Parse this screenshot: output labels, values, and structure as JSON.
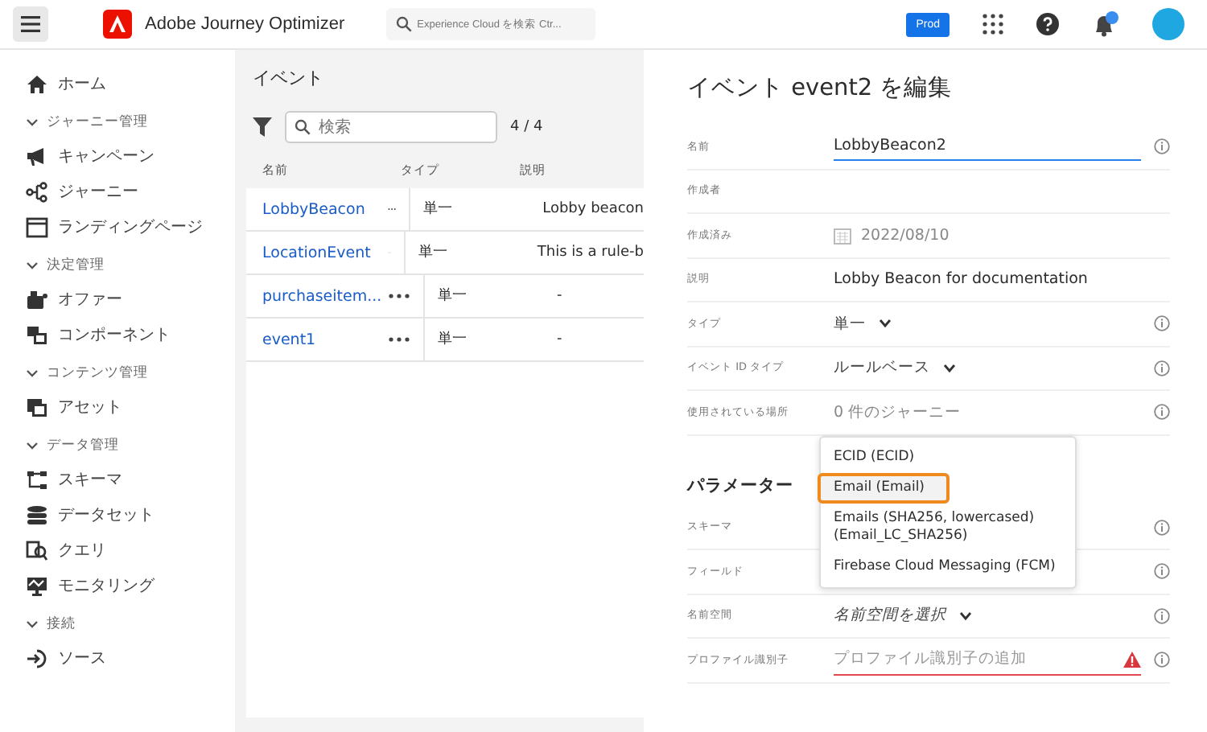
{
  "app": {
    "title": "Adobe Journey Optimizer",
    "search_placeholder": "Experience Cloud を検索 Ctr...",
    "sandbox": "Prod"
  },
  "sidebar": [
    {
      "kind": "item",
      "label": "ホーム"
    },
    {
      "kind": "section",
      "label": "ジャーニー管理",
      "expanded": true
    },
    {
      "kind": "item",
      "label": "キャンペーン"
    },
    {
      "kind": "item",
      "label": "ジャーニー"
    },
    {
      "kind": "item",
      "label": "ランディングページ"
    },
    {
      "kind": "section",
      "label": "決定管理",
      "expanded": true
    },
    {
      "kind": "item",
      "label": "オファー"
    },
    {
      "kind": "item",
      "label": "コンポーネント"
    },
    {
      "kind": "section",
      "label": "コンテンツ管理",
      "expanded": true
    },
    {
      "kind": "item",
      "label": "アセット"
    },
    {
      "kind": "section",
      "label": "データ管理",
      "expanded": true
    },
    {
      "kind": "item",
      "label": "スキーマ"
    },
    {
      "kind": "item",
      "label": "データセット"
    },
    {
      "kind": "item",
      "label": "クエリ"
    },
    {
      "kind": "item",
      "label": "モニタリング"
    },
    {
      "kind": "section",
      "label": "接続",
      "expanded": true
    },
    {
      "kind": "item",
      "label": "ソース"
    }
  ],
  "events": {
    "title": "イベント",
    "search_placeholder": "検索",
    "count": "4 / 4",
    "columns": [
      "名前",
      "タイプ",
      "説明"
    ],
    "rows": [
      {
        "name": "LobbyBeacon",
        "type": "単一",
        "description": "Lobby beacon"
      },
      {
        "name": "LocationEvent",
        "type": "単一",
        "description": "This is a rule-b"
      },
      {
        "name": "purchaseitem...",
        "type": "単一",
        "description": "-"
      },
      {
        "name": "event1",
        "type": "単一",
        "description": "-"
      }
    ]
  },
  "editor": {
    "title": "イベント event2 を編集",
    "fields": [
      {
        "label": "名前",
        "kind": "input",
        "value": "LobbyBeacon2",
        "info": true
      },
      {
        "label": "作成者",
        "kind": "plain",
        "info": false
      },
      {
        "label": "作成済み",
        "kind": "date",
        "value": "2022/08/10",
        "info": false
      },
      {
        "label": "説明",
        "kind": "plain",
        "value": "Lobby Beacon for documentation",
        "info": false
      },
      {
        "label": "タイプ",
        "kind": "select",
        "value": "単一",
        "info": true
      },
      {
        "label": "イベント ID タイプ",
        "kind": "select",
        "value": "ルールベース",
        "info": true
      },
      {
        "label": "使用されている場所",
        "kind": "muted",
        "value": "0 件のジャーニー",
        "info": true
      }
    ],
    "parameters_title": "パラメーター",
    "parameters": [
      {
        "label": "スキーマ",
        "kind": "plain",
        "info": true
      },
      {
        "label": "フィールド",
        "kind": "plain",
        "info": true
      },
      {
        "label": "名前空間",
        "kind": "select-italic",
        "value": "名前空間を選択",
        "info": true
      },
      {
        "label": "プロファイル識別子",
        "kind": "error",
        "placeholder": "プロファイル識別子の追加",
        "info": true
      }
    ],
    "dropdown": [
      {
        "label": "ECID (ECID)",
        "selected": false
      },
      {
        "label": "Email (Email)",
        "selected": true
      },
      {
        "label": "Emails (SHA256, lowercased) (Email_LC_SHA256)",
        "selected": false
      },
      {
        "label": "Firebase Cloud Messaging (FCM)",
        "selected": false
      }
    ]
  }
}
